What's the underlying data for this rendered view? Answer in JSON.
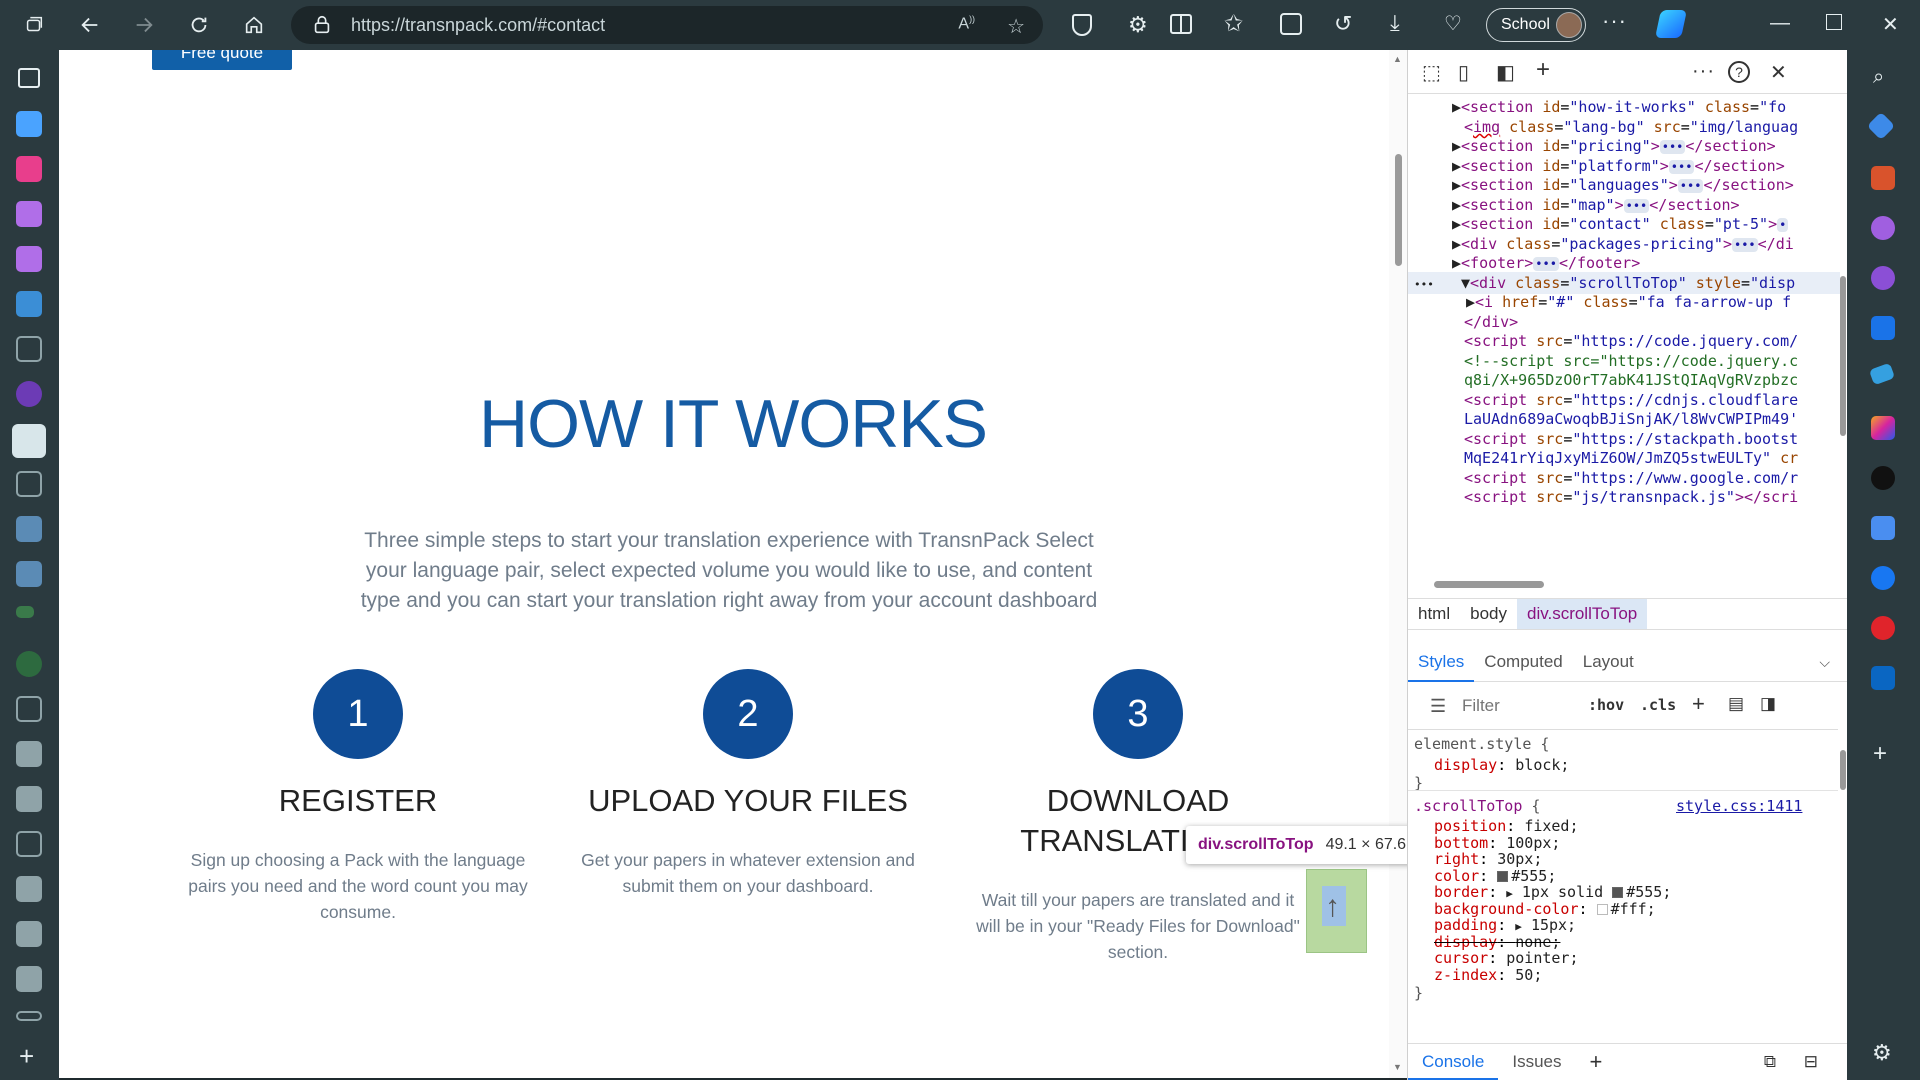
{
  "browser": {
    "url": "https://transnpack.com/#contact",
    "profile": "School"
  },
  "page": {
    "quote_button": "Free quote",
    "how_title": "HOW IT WORKS",
    "how_sub": "Three simple steps to start your translation experience with TransnPack Select your language pair, select expected volume you would like to use, and content type and you can start your translation right away from your account dashboard",
    "steps": [
      {
        "num": "1",
        "title": "REGISTER",
        "desc": "Sign up choosing a Pack with the language pairs you need and the word count you may consume."
      },
      {
        "num": "2",
        "title": "UPLOAD YOUR FILES",
        "desc": "Get your papers in whatever extension and submit them on your dashboard."
      },
      {
        "num": "3",
        "title": "DOWNLOAD TRANSLATIONS",
        "desc": "Wait till your papers are translated and it will be in your \"Ready Files for Download\" section."
      }
    ],
    "tooltip": {
      "selector": "div.scrollToTop",
      "dims": "49.1 × 67.6"
    }
  },
  "devtools": {
    "breadcrumbs": [
      "html",
      "body",
      "div.scrollToTop"
    ],
    "tabs": [
      "Styles",
      "Computed",
      "Layout"
    ],
    "filter_placeholder": "Filter",
    "filter_buttons": [
      ":hov",
      ".cls"
    ],
    "rule_source": "style.css:1411",
    "bottom_tabs": [
      "Console",
      "Issues"
    ],
    "colors": {
      "accent": "#1a73e8",
      "tag": "#881280"
    }
  }
}
